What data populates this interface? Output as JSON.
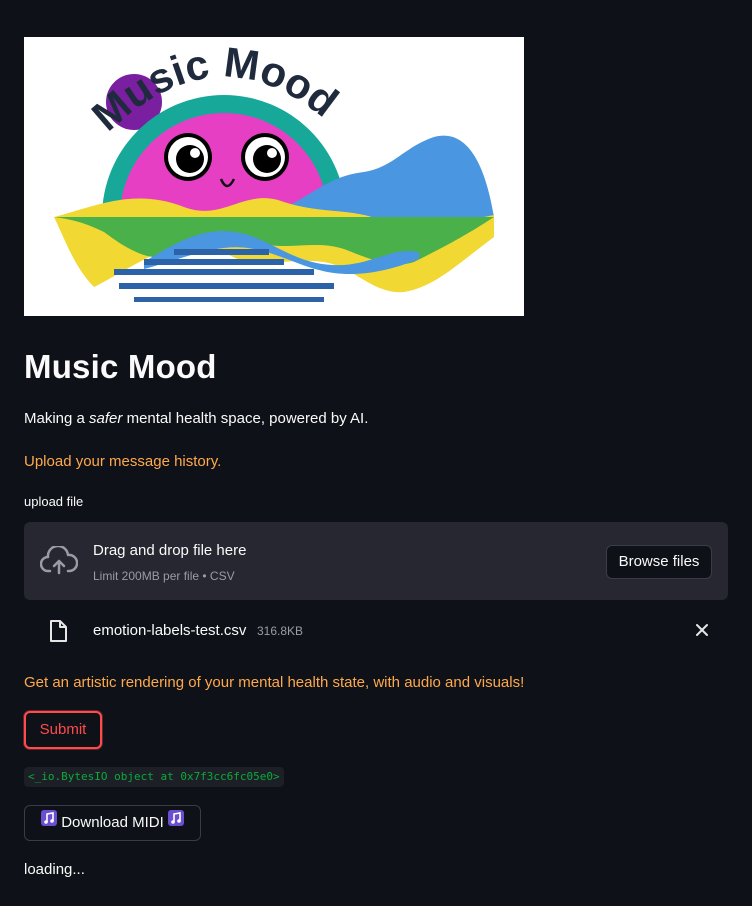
{
  "logo": {
    "text": "Music Mood",
    "icon": "music-mood-logo"
  },
  "page": {
    "title": "Music Mood",
    "tagline_prefix": "Making a ",
    "tagline_emphasis": "safer",
    "tagline_suffix": " mental health space, powered by AI.",
    "upload_prompt": "Upload your message history.",
    "render_prompt": "Get an artistic rendering of your mental health state, with audio and visuals!",
    "loading": "loading..."
  },
  "uploader": {
    "label": "upload file",
    "drag_text": "Drag and drop file here",
    "limit_text": "Limit 200MB per file • CSV",
    "browse_label": "Browse files",
    "icon": "cloud-upload-icon"
  },
  "uploaded_file": {
    "name": "emotion-labels-test.csv",
    "size": "316.8KB",
    "icon": "file-icon"
  },
  "actions": {
    "submit_label": "Submit",
    "download_label": "Download MIDI",
    "download_icon": "music-note-icon"
  },
  "output": {
    "code_text": "<_io.BytesIO object at 0x7f3cc6fc05e0>"
  },
  "colors": {
    "background": "#0e1117",
    "accent_orange": "#ffa94d",
    "submit_red": "#ff4b4b",
    "code_green": "#09ab3b",
    "note_purple": "#8a6ce0"
  }
}
